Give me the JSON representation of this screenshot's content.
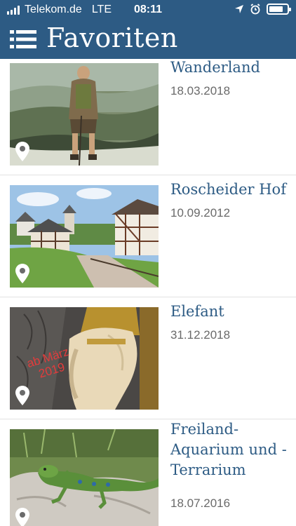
{
  "status_bar": {
    "carrier": "Telekom.de",
    "network": "LTE",
    "time": "08:11"
  },
  "header": {
    "title": "Favoriten",
    "background": "#2d5b84",
    "menu_icon": "hamburger-menu-icon"
  },
  "colors": {
    "accent": "#2d5b84",
    "date_text": "#6a6a6a"
  },
  "favorites": [
    {
      "title": "Wanderland",
      "date": "18.03.2018",
      "icon": "location-pin-icon"
    },
    {
      "title": "Roscheider Hof",
      "date": "10.09.2012",
      "icon": "location-pin-icon"
    },
    {
      "title": "Elefant",
      "date": "31.12.2018",
      "icon": "location-pin-icon",
      "image_overlay_text": "ab März 2019"
    },
    {
      "title": "Freiland-Aquarium und -Terrarium",
      "date": "18.07.2016",
      "icon": "location-pin-icon"
    }
  ]
}
